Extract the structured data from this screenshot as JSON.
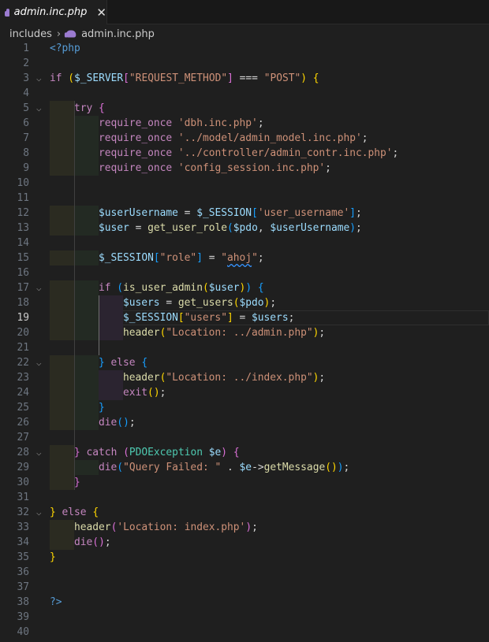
{
  "tab": {
    "title": "admin.inc.php",
    "icon": "php-elephant-icon",
    "close": "✕"
  },
  "breadcrumb": {
    "folder": "includes",
    "separator": "›",
    "file": "admin.inc.php"
  },
  "editor": {
    "active_line": 19,
    "lines": [
      {
        "n": 1,
        "indent": 0,
        "tokens": [
          [
            "<?php",
            "tag"
          ]
        ]
      },
      {
        "n": 2,
        "indent": 0,
        "tokens": []
      },
      {
        "n": 3,
        "indent": 0,
        "fold": true,
        "tokens": [
          [
            "if ",
            "k"
          ],
          [
            "(",
            "bg"
          ],
          [
            "$_SERVER",
            "v"
          ],
          [
            "[",
            "bp"
          ],
          [
            "\"REQUEST_METHOD\"",
            "s"
          ],
          [
            "]",
            "bp"
          ],
          [
            " === ",
            "p"
          ],
          [
            "\"POST\"",
            "s"
          ],
          [
            ")",
            "bg"
          ],
          [
            " ",
            "p"
          ],
          [
            "{",
            "bg"
          ]
        ]
      },
      {
        "n": 4,
        "indent": 0,
        "tokens": []
      },
      {
        "n": 5,
        "indent": 1,
        "fold": true,
        "tokens": [
          [
            "try ",
            "k"
          ],
          [
            "{",
            "bp"
          ]
        ]
      },
      {
        "n": 6,
        "indent": 2,
        "tokens": [
          [
            "require_once ",
            "k"
          ],
          [
            "'dbh.inc.php'",
            "s"
          ],
          [
            ";",
            "p"
          ]
        ]
      },
      {
        "n": 7,
        "indent": 2,
        "tokens": [
          [
            "require_once ",
            "k"
          ],
          [
            "'../model/admin_model.inc.php'",
            "s"
          ],
          [
            ";",
            "p"
          ]
        ]
      },
      {
        "n": 8,
        "indent": 2,
        "tokens": [
          [
            "require_once ",
            "k"
          ],
          [
            "'../controller/admin_contr.inc.php'",
            "s"
          ],
          [
            ";",
            "p"
          ]
        ]
      },
      {
        "n": 9,
        "indent": 2,
        "tokens": [
          [
            "require_once ",
            "k"
          ],
          [
            "'config_session.inc.php'",
            "s"
          ],
          [
            ";",
            "p"
          ]
        ]
      },
      {
        "n": 10,
        "indent": 0,
        "tokens": []
      },
      {
        "n": 11,
        "indent": 0,
        "tokens": []
      },
      {
        "n": 12,
        "indent": 2,
        "tokens": [
          [
            "$userUsername",
            "v"
          ],
          [
            " = ",
            "p"
          ],
          [
            "$_SESSION",
            "v"
          ],
          [
            "[",
            "bb"
          ],
          [
            "'user_username'",
            "s"
          ],
          [
            "]",
            "bb"
          ],
          [
            ";",
            "p"
          ]
        ]
      },
      {
        "n": 13,
        "indent": 2,
        "tokens": [
          [
            "$user",
            "v"
          ],
          [
            " = ",
            "p"
          ],
          [
            "get_user_role",
            "f"
          ],
          [
            "(",
            "bb"
          ],
          [
            "$pdo",
            "v"
          ],
          [
            ", ",
            "p"
          ],
          [
            "$userUsername",
            "v"
          ],
          [
            ")",
            "bb"
          ],
          [
            ";",
            "p"
          ]
        ]
      },
      {
        "n": 14,
        "indent": 0,
        "tokens": []
      },
      {
        "n": 15,
        "indent": 2,
        "tokens": [
          [
            "$_SESSION",
            "v"
          ],
          [
            "[",
            "bb"
          ],
          [
            "\"role\"",
            "s"
          ],
          [
            "]",
            "bb"
          ],
          [
            " = ",
            "p"
          ],
          [
            "\"",
            "s"
          ],
          [
            "ahoj",
            "sq"
          ],
          [
            "\"",
            "s"
          ],
          [
            ";",
            "p"
          ]
        ]
      },
      {
        "n": 16,
        "indent": 0,
        "tokens": []
      },
      {
        "n": 17,
        "indent": 2,
        "fold": true,
        "tokens": [
          [
            "if ",
            "k"
          ],
          [
            "(",
            "bb"
          ],
          [
            "is_user_admin",
            "f"
          ],
          [
            "(",
            "bg"
          ],
          [
            "$user",
            "v"
          ],
          [
            ")",
            "bg"
          ],
          [
            ")",
            "bb"
          ],
          [
            " ",
            "p"
          ],
          [
            "{",
            "bb"
          ]
        ]
      },
      {
        "n": 18,
        "indent": 3,
        "tokens": [
          [
            "$users",
            "v"
          ],
          [
            " = ",
            "p"
          ],
          [
            "get_users",
            "f"
          ],
          [
            "(",
            "bg"
          ],
          [
            "$pdo",
            "v"
          ],
          [
            ")",
            "bg"
          ],
          [
            ";",
            "p"
          ]
        ]
      },
      {
        "n": 19,
        "indent": 3,
        "tokens": [
          [
            "$_SESSION",
            "v"
          ],
          [
            "[",
            "bg"
          ],
          [
            "\"users\"",
            "s"
          ],
          [
            "]",
            "bg"
          ],
          [
            " = ",
            "p"
          ],
          [
            "$users",
            "v"
          ],
          [
            ";",
            "p"
          ]
        ]
      },
      {
        "n": 20,
        "indent": 3,
        "tokens": [
          [
            "header",
            "f"
          ],
          [
            "(",
            "bg"
          ],
          [
            "\"Location: ../admin.php\"",
            "s"
          ],
          [
            ")",
            "bg"
          ],
          [
            ";",
            "p"
          ]
        ]
      },
      {
        "n": 21,
        "indent": 0,
        "tokens": []
      },
      {
        "n": 22,
        "indent": 2,
        "fold": true,
        "tokens": [
          [
            "}",
            "bb"
          ],
          [
            " else ",
            "k"
          ],
          [
            "{",
            "bb"
          ]
        ]
      },
      {
        "n": 23,
        "indent": 3,
        "tokens": [
          [
            "header",
            "f"
          ],
          [
            "(",
            "bg"
          ],
          [
            "\"Location: ../index.php\"",
            "s"
          ],
          [
            ")",
            "bg"
          ],
          [
            ";",
            "p"
          ]
        ]
      },
      {
        "n": 24,
        "indent": 3,
        "tokens": [
          [
            "exit",
            "k"
          ],
          [
            "(",
            "bg"
          ],
          [
            ")",
            "bg"
          ],
          [
            ";",
            "p"
          ]
        ]
      },
      {
        "n": 25,
        "indent": 2,
        "tokens": [
          [
            "}",
            "bb"
          ]
        ]
      },
      {
        "n": 26,
        "indent": 2,
        "tokens": [
          [
            "die",
            "k"
          ],
          [
            "(",
            "bb"
          ],
          [
            ")",
            "bb"
          ],
          [
            ";",
            "p"
          ]
        ]
      },
      {
        "n": 27,
        "indent": 0,
        "tokens": []
      },
      {
        "n": 28,
        "indent": 1,
        "fold": true,
        "tokens": [
          [
            "}",
            "bp"
          ],
          [
            " catch ",
            "k"
          ],
          [
            "(",
            "bp"
          ],
          [
            "PDOException",
            "t"
          ],
          [
            " ",
            "p"
          ],
          [
            "$e",
            "v"
          ],
          [
            ")",
            "bp"
          ],
          [
            " ",
            "p"
          ],
          [
            "{",
            "bp"
          ]
        ]
      },
      {
        "n": 29,
        "indent": 2,
        "tokens": [
          [
            "die",
            "k"
          ],
          [
            "(",
            "bb"
          ],
          [
            "\"Query Failed: \"",
            "s"
          ],
          [
            " . ",
            "p"
          ],
          [
            "$e",
            "v"
          ],
          [
            "->",
            "p"
          ],
          [
            "getMessage",
            "f"
          ],
          [
            "(",
            "bg"
          ],
          [
            ")",
            "bg"
          ],
          [
            ")",
            "bb"
          ],
          [
            ";",
            "p"
          ]
        ]
      },
      {
        "n": 30,
        "indent": 1,
        "tokens": [
          [
            "}",
            "bp"
          ]
        ]
      },
      {
        "n": 31,
        "indent": 0,
        "tokens": []
      },
      {
        "n": 32,
        "indent": 0,
        "fold": true,
        "tokens": [
          [
            "}",
            "bg"
          ],
          [
            " else ",
            "k"
          ],
          [
            "{",
            "bg"
          ]
        ]
      },
      {
        "n": 33,
        "indent": 1,
        "tokens": [
          [
            "header",
            "f"
          ],
          [
            "(",
            "bp"
          ],
          [
            "'Location: index.php'",
            "s"
          ],
          [
            ")",
            "bp"
          ],
          [
            ";",
            "p"
          ]
        ]
      },
      {
        "n": 34,
        "indent": 1,
        "tokens": [
          [
            "die",
            "k"
          ],
          [
            "(",
            "bp"
          ],
          [
            ")",
            "bp"
          ],
          [
            ";",
            "p"
          ]
        ]
      },
      {
        "n": 35,
        "indent": 0,
        "tokens": [
          [
            "}",
            "bg"
          ]
        ]
      },
      {
        "n": 36,
        "indent": 0,
        "tokens": []
      },
      {
        "n": 37,
        "indent": 0,
        "tokens": []
      },
      {
        "n": 38,
        "indent": 0,
        "tokens": [
          [
            "?>",
            "tag"
          ]
        ]
      },
      {
        "n": 39,
        "indent": 0,
        "tokens": []
      },
      {
        "n": 40,
        "indent": 0,
        "tokens": []
      }
    ]
  }
}
